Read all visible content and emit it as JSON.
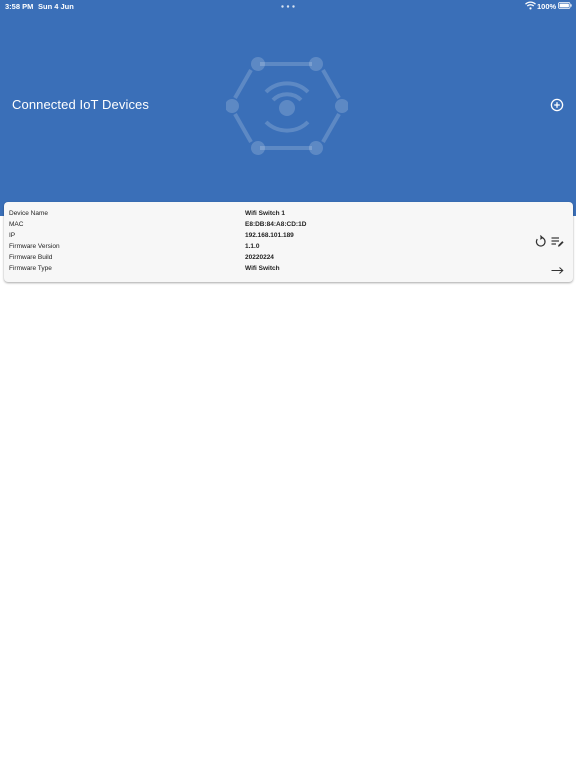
{
  "status_bar": {
    "time": "3:58 PM",
    "date": "Sun 4 Jun",
    "battery": "100%"
  },
  "header": {
    "title": "Connected IoT Devices",
    "add_icon": "add-circle-icon",
    "logo_icon": "iot-hub-icon"
  },
  "colors": {
    "header_bg": "#3a6fb8",
    "card_bg": "#f7f7f7"
  },
  "device": {
    "rows": [
      {
        "label": "Device Name",
        "value": "Wifi Switch 1"
      },
      {
        "label": "MAC",
        "value": "E8:DB:84:A8:CD:1D"
      },
      {
        "label": "IP",
        "value": "192.168.101.189"
      },
      {
        "label": "Firmware Version",
        "value": "1.1.0"
      },
      {
        "label": "Firmware Build",
        "value": "20220224"
      },
      {
        "label": "Firmware Type",
        "value": "Wifi Switch"
      }
    ],
    "actions": {
      "reset_icon": "restart-icon",
      "edit_icon": "edit-list-icon",
      "open_icon": "arrow-right-icon"
    }
  }
}
